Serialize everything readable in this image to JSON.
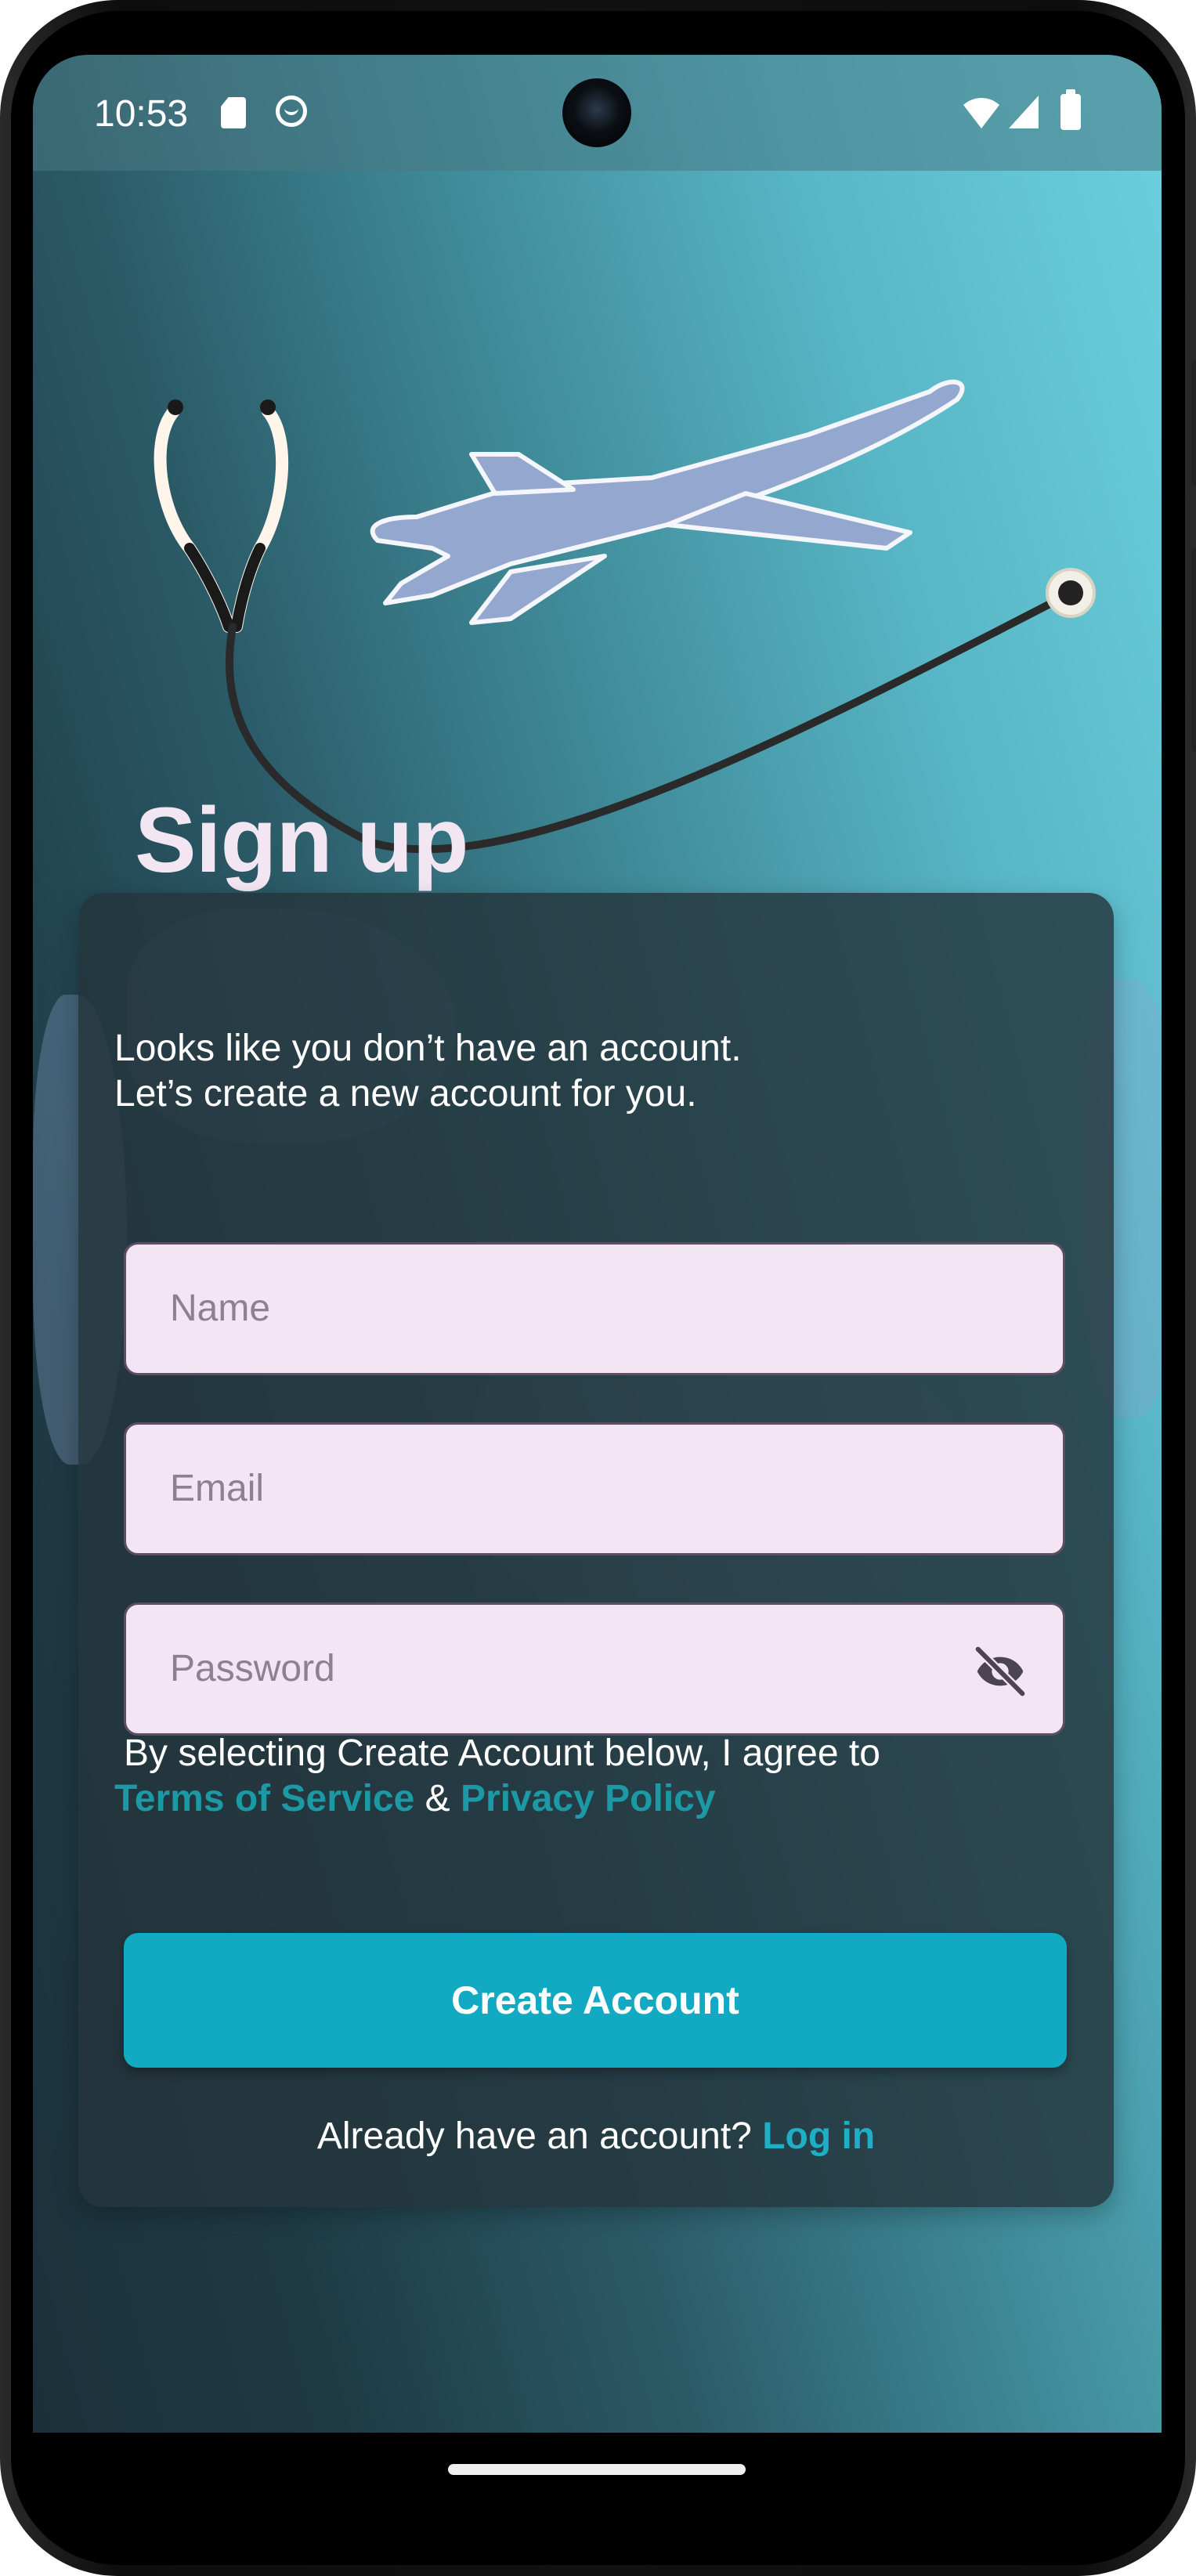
{
  "status_bar": {
    "time": "10:53",
    "icons": [
      "sd-card-icon",
      "android-debug-icon",
      "wifi-icon",
      "cellular-signal-icon",
      "battery-icon"
    ]
  },
  "header": {
    "title": "Sign up",
    "illustration": "stethoscope-airplane-illustration"
  },
  "card": {
    "intro_line1": "Looks like you don’t have an account.",
    "intro_line2": "Let’s create a new account for you.",
    "fields": {
      "name": {
        "placeholder": "Name",
        "value": ""
      },
      "email": {
        "placeholder": "Email",
        "value": ""
      },
      "password": {
        "placeholder": "Password",
        "value": "",
        "toggle_icon": "eye-off-icon"
      }
    },
    "terms": {
      "prefix": "By selecting Create Account below,   I agree to",
      "terms_link": "Terms of Service",
      "ampersand": "&",
      "privacy_link": "Privacy Policy"
    },
    "create_button": "Create Account",
    "login_prompt": "Already have an account?",
    "login_link": "Log in"
  },
  "colors": {
    "accent": "#12aac3",
    "link": "#1b9aa5",
    "field_bg": "#f3e5f4",
    "title": "#f3e6f3"
  }
}
